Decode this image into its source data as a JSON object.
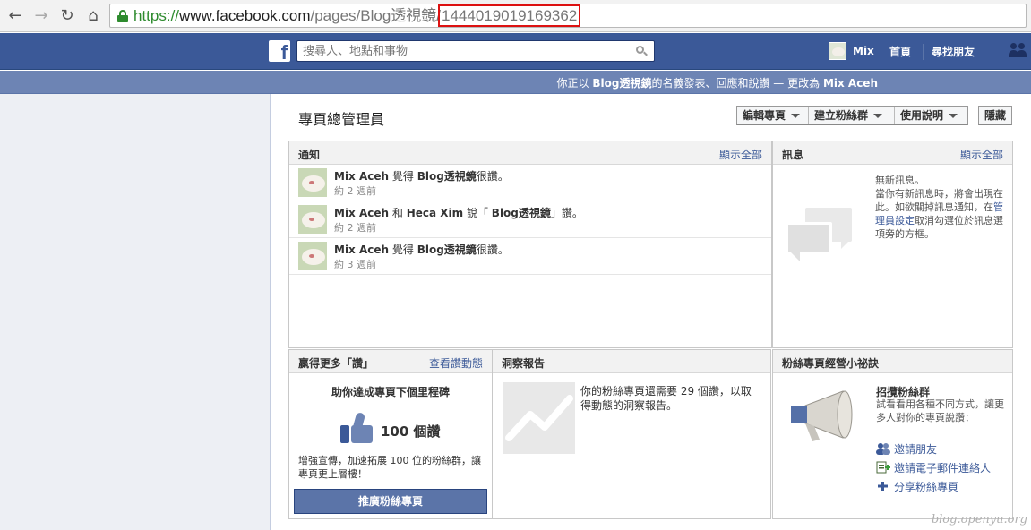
{
  "browser": {
    "url_scheme": "https://",
    "url_host": "www.facebook.com",
    "url_path": "/pages/Blog透視鏡/",
    "url_id": "144401901916936​2"
  },
  "fb": {
    "logo": "f",
    "search_placeholder": "搜尋人、地點和事物",
    "user_name": "Mix",
    "home": "首頁",
    "find_friends": "尋找朋友"
  },
  "acting": {
    "prefix": "你正以 ",
    "page_name": "Blog透視鏡",
    "middle": "的名義發表、回應和說讚 — 更改為 ",
    "person": "Mix Aceh"
  },
  "admin": {
    "title": "專頁總管理員",
    "edit_page": "編輯專頁",
    "build_audience": "建立粉絲群",
    "help": "使用說明",
    "hide": "隱藏"
  },
  "notifications": {
    "title": "通知",
    "see_all": "顯示全部",
    "items": [
      {
        "actor": "Mix Aceh",
        "verb": " 覺得 ",
        "target": "Blog透視鏡",
        "suffix": "很讚。",
        "time": "約 2 週前"
      },
      {
        "actor": "Mix Aceh",
        "verb": " 和 ",
        "actor2": "Heca Xim",
        "verb2": " 說「 ",
        "target": "Blog透視鏡",
        "suffix": "」讚。",
        "time": "約 2 週前"
      },
      {
        "actor": "Mix Aceh",
        "verb": " 覺得 ",
        "target": "Blog透視鏡",
        "suffix": "很讚。",
        "time": "約 3 週前"
      }
    ]
  },
  "messages": {
    "title": "訊息",
    "see_all": "顯示全部",
    "empty": "無新訊息。",
    "desc_1": "當你有新訊息時，將會出現在此。如欲關掉訊息通知，在",
    "desc_link": "管理員設定",
    "desc_2": "取消勾選位於訊息選項旁的方框。"
  },
  "likes": {
    "title": "贏得更多「讚」",
    "link": "查看讚動態",
    "heading": "助你達成專頁下個里程碑",
    "count": "100 個讚",
    "desc": "增強宣傳，加速拓展 100 位的粉絲群，讓專頁更上層樓！",
    "button": "推廣粉絲專頁"
  },
  "insights": {
    "title": "洞察報告",
    "text": "你的粉絲專頁還需要 29 個讚，以取得動態的洞察報告。"
  },
  "tips": {
    "title": "粉絲專頁經營小祕訣",
    "subtitle": "招攬粉絲群",
    "desc": "試看看用各種不同方式，讓更多人對你的專頁說讚：",
    "invite_friends": "邀請朋友",
    "invite_email": "邀請電子郵件連絡人",
    "share_page": "分享粉絲專頁"
  },
  "watermark": "blog.openyu.org"
}
